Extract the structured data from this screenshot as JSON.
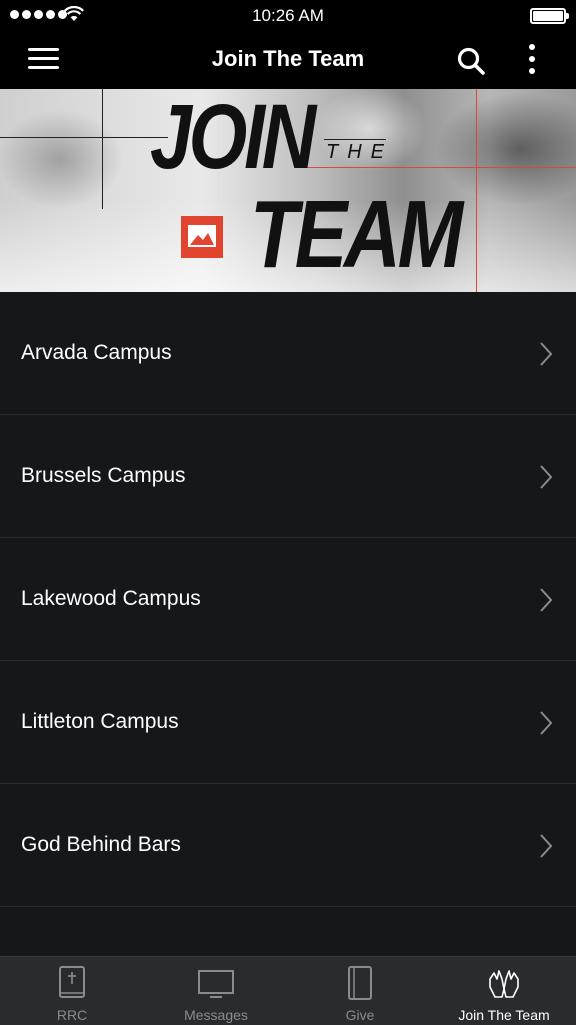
{
  "status_bar": {
    "time": "10:26 AM"
  },
  "nav": {
    "title": "Join The Team"
  },
  "banner": {
    "line1": "JOIN",
    "line2": "THE",
    "line3": "TEAM"
  },
  "list": {
    "items": [
      {
        "label": "Arvada Campus"
      },
      {
        "label": "Brussels Campus"
      },
      {
        "label": "Lakewood Campus"
      },
      {
        "label": "Littleton Campus"
      },
      {
        "label": "God Behind Bars"
      }
    ]
  },
  "tabbar": {
    "tabs": [
      {
        "label": "RRC",
        "icon": "bible-icon"
      },
      {
        "label": "Messages",
        "icon": "monitor-icon"
      },
      {
        "label": "Give",
        "icon": "book-icon"
      },
      {
        "label": "Join The Team",
        "icon": "hands-icon"
      }
    ],
    "active_tab": "Join The Team"
  },
  "colors": {
    "background": "#161719",
    "navbar": "#000000",
    "tabbar": "#2a2b2e",
    "accent_logo": "#e2452f",
    "inactive_tab": "#8a8b8e"
  }
}
